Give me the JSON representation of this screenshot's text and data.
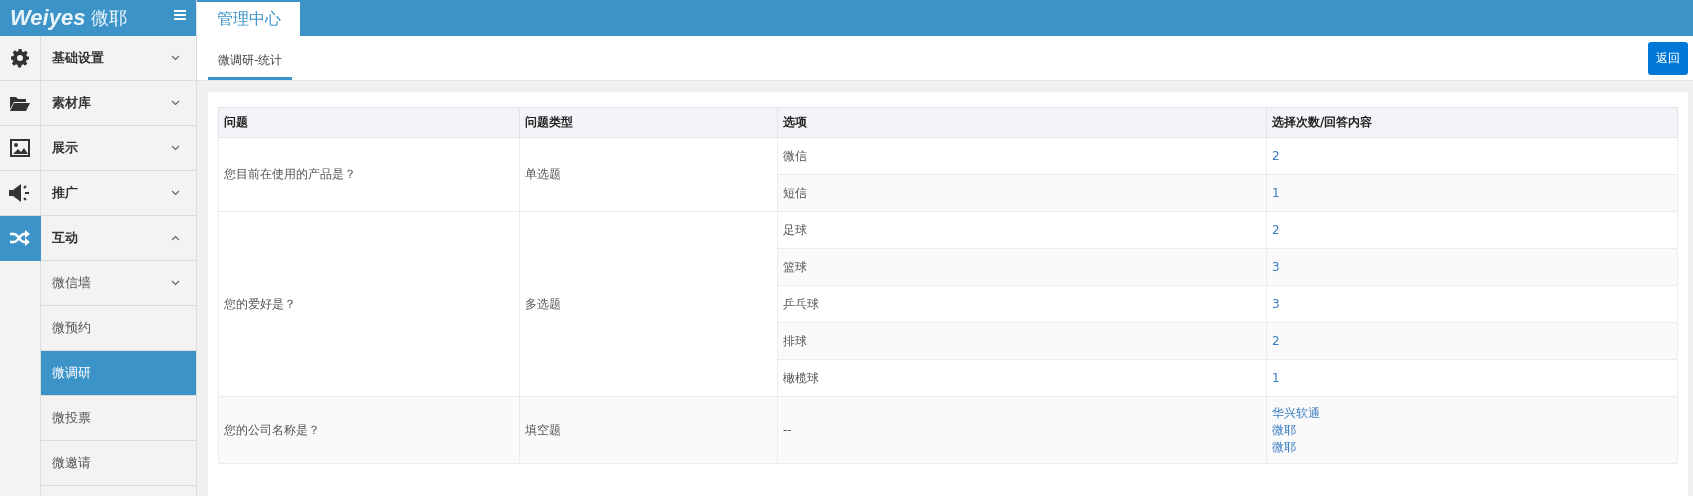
{
  "logo": {
    "brand": "Weiyes",
    "name": "微耶"
  },
  "header": {
    "tabs": [
      {
        "label": "管理中心",
        "selected": true
      }
    ]
  },
  "sidebar": {
    "items": [
      {
        "label": "基础设置",
        "kind": "gear",
        "expanded": false
      },
      {
        "label": "素材库",
        "kind": "folder",
        "expanded": false
      },
      {
        "label": "展示",
        "kind": "image",
        "expanded": false
      },
      {
        "label": "推广",
        "kind": "speaker",
        "expanded": false
      },
      {
        "label": "互动",
        "kind": "shuffle",
        "expanded": true,
        "children": [
          {
            "label": "微信墙",
            "kind": "submenu",
            "expanded": false,
            "selected": false
          },
          {
            "label": "微预约",
            "kind": "link",
            "selected": false
          },
          {
            "label": "微调研",
            "kind": "link",
            "selected": true
          },
          {
            "label": "微投票",
            "kind": "link",
            "selected": false
          },
          {
            "label": "微邀请",
            "kind": "link",
            "selected": false
          }
        ]
      }
    ]
  },
  "subtabs": [
    {
      "label": "微调研-统计",
      "selected": true
    }
  ],
  "back_button": "返回",
  "table": {
    "columns": [
      "问题",
      "问题类型",
      "选项",
      "选择次数/回答内容"
    ],
    "rows": [
      {
        "question": "您目前在使用的产品是？",
        "type": "单选题",
        "options": [
          {
            "label": "微信",
            "answers": [
              "2"
            ]
          },
          {
            "label": "短信",
            "answers": [
              "1"
            ]
          }
        ]
      },
      {
        "question": "您的爱好是？",
        "type": "多选题",
        "options": [
          {
            "label": "足球",
            "answers": [
              "2"
            ]
          },
          {
            "label": "篮球",
            "answers": [
              "3"
            ]
          },
          {
            "label": "乒乓球",
            "answers": [
              "3"
            ]
          },
          {
            "label": "排球",
            "answers": [
              "2"
            ]
          },
          {
            "label": "橄榄球",
            "answers": [
              "1"
            ]
          }
        ]
      },
      {
        "question": "您的公司名称是？",
        "type": "填空题",
        "options": [
          {
            "label": "--",
            "answers": [
              "华兴软通",
              "微耶",
              "微耶"
            ]
          }
        ]
      }
    ]
  }
}
